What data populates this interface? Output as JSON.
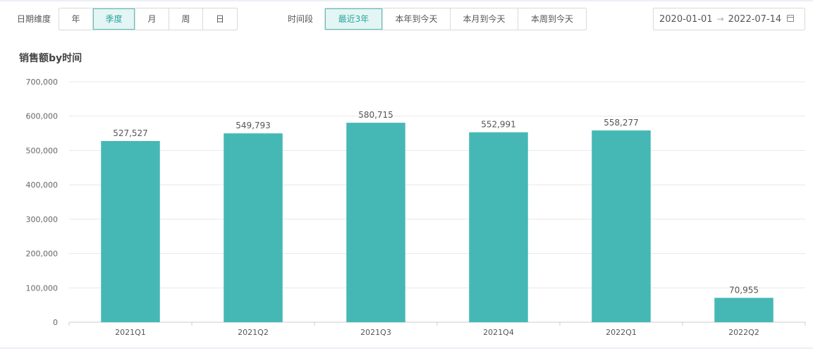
{
  "filters": {
    "date_dimension_label": "日期维度",
    "date_dimension_options": [
      "年",
      "季度",
      "月",
      "周",
      "日"
    ],
    "date_dimension_selected": 1,
    "period_label": "时间段",
    "period_options": [
      "最近3年",
      "本年到今天",
      "本月到今天",
      "本周到今天"
    ],
    "period_selected": 0,
    "date_start": "2020-01-01",
    "date_arrow": "→",
    "date_end": "2022-07-14"
  },
  "colors": {
    "bar": "#45b8b6",
    "accent": "#2aa59f",
    "grid": "#e8e8e8"
  },
  "chart_data": {
    "type": "bar",
    "title": "销售额by时间",
    "categories": [
      "2021Q1",
      "2021Q2",
      "2021Q3",
      "2021Q4",
      "2022Q1",
      "2022Q2"
    ],
    "values": [
      527527,
      549793,
      580715,
      552991,
      558277,
      70955
    ],
    "value_labels": [
      "527,527",
      "549,793",
      "580,715",
      "552,991",
      "558,277",
      "70,955"
    ],
    "yticks": [
      0,
      100000,
      200000,
      300000,
      400000,
      500000,
      600000,
      700000
    ],
    "ytick_labels": [
      "0",
      "100,000",
      "200,000",
      "300,000",
      "400,000",
      "500,000",
      "600,000",
      "700,000"
    ],
    "ylim": [
      0,
      700000
    ],
    "grid": true,
    "xlabel": "",
    "ylabel": ""
  }
}
